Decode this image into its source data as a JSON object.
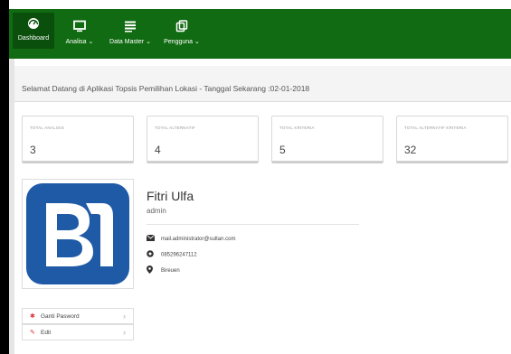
{
  "nav": {
    "dashboard": "Dashboard",
    "analisa": "Analisa ⌄",
    "data_master": "Data Master ⌄",
    "pengguna": "Pengguna ⌄"
  },
  "welcome_text": "Selamat Datang di Aplikasi Topsis Pemilihan Lokasi - Tanggal Sekarang :02-01-2018",
  "stats": [
    {
      "title": "TOTAL ANALISIS",
      "value": "3"
    },
    {
      "title": "TOTAL ALTERNATIF",
      "value": "4"
    },
    {
      "title": "TOTAL KRITERIA",
      "value": "5"
    },
    {
      "title": "TOTAL ALTERNATIF KRITERIA",
      "value": "32"
    }
  ],
  "profile": {
    "name": "Fitri Ulfa",
    "role": "admin",
    "email": "mail.administrator@sultan.com",
    "phone": "085296247112",
    "location": "Bireuen"
  },
  "actions": {
    "ganti_password": "Ganti Pasword",
    "edit": "Edit"
  },
  "colors": {
    "navbar": "#116b12",
    "nav_active": "#0a4f0b",
    "logo_blue": "#1f5aa6",
    "accent_red": "#d9333a"
  },
  "icons": {
    "dashboard": "dashboard-icon",
    "analisa": "monitor-icon",
    "data_master": "list-icon",
    "pengguna": "users-icon",
    "email": "envelope-icon",
    "phone": "globe-icon",
    "location": "map-marker-icon",
    "ganti_password": "asterisk-icon",
    "edit": "pencil-icon"
  }
}
